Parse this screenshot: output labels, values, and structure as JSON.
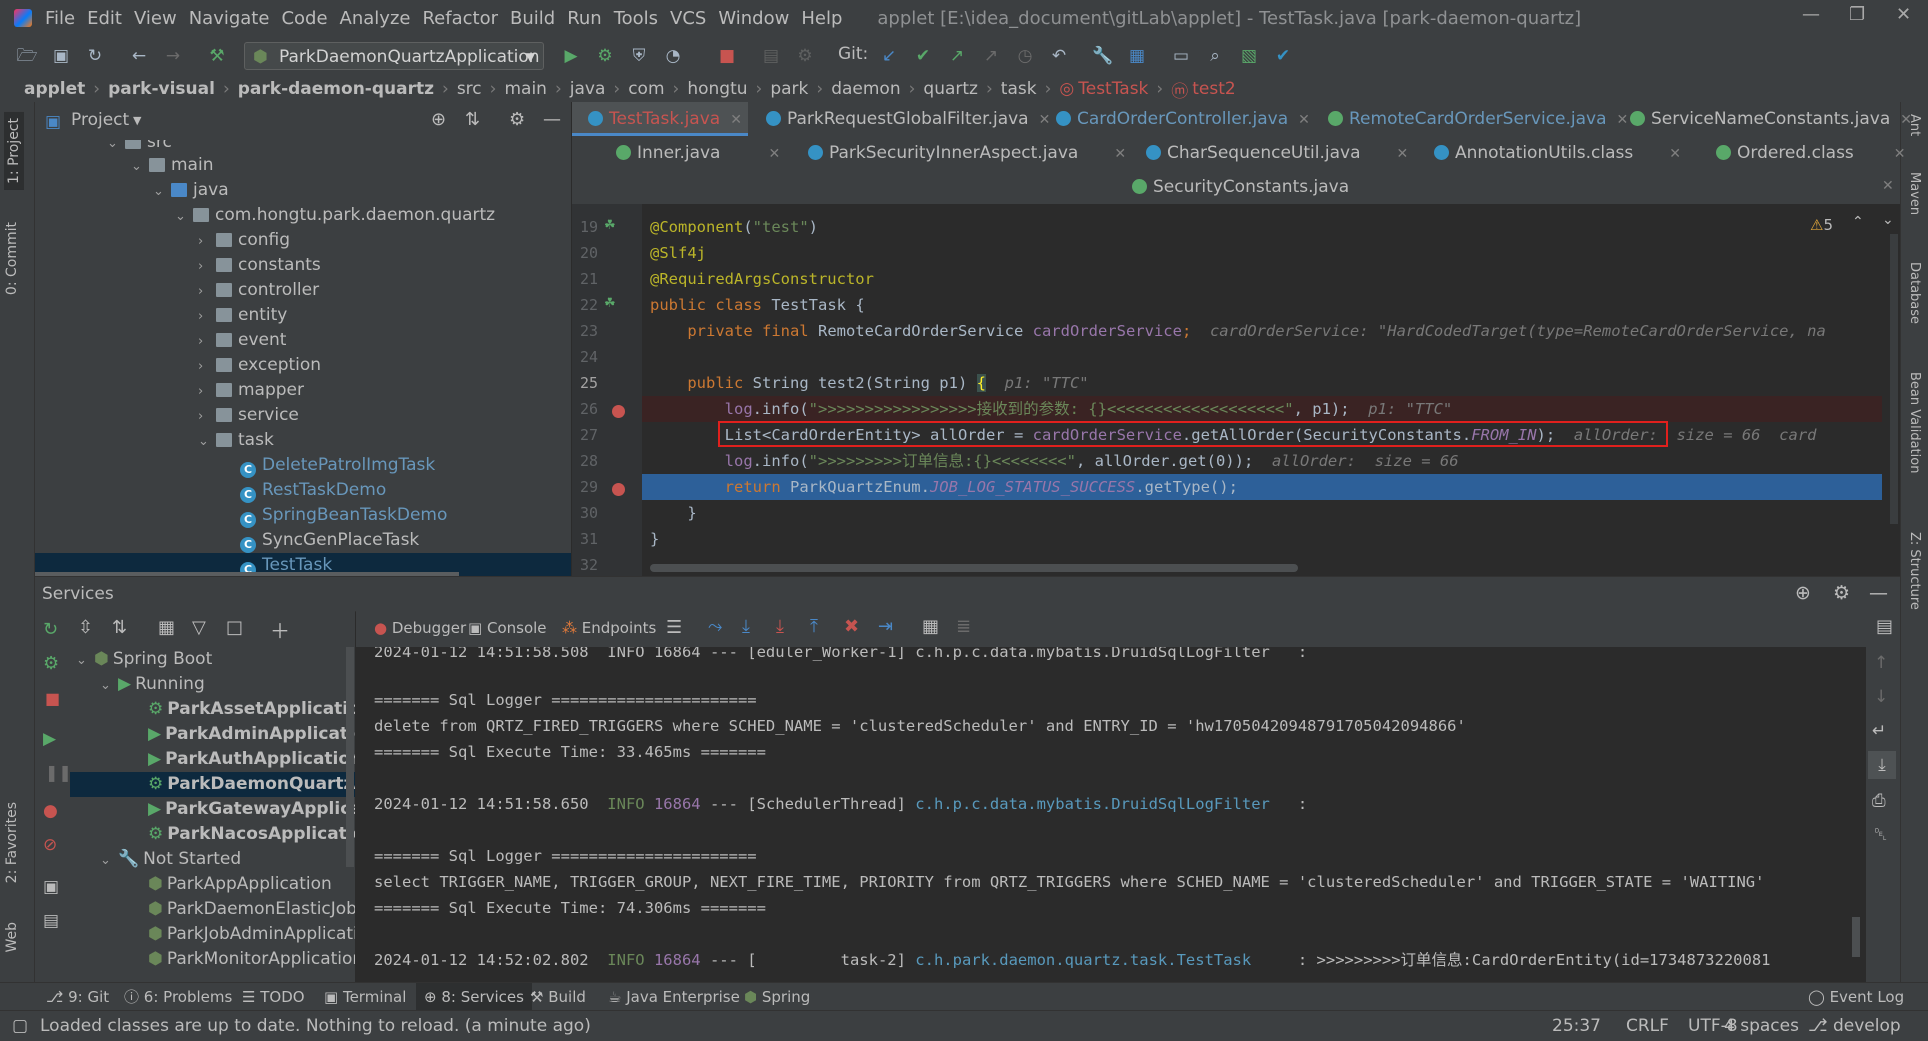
{
  "menu": {
    "items": [
      "File",
      "Edit",
      "View",
      "Navigate",
      "Code",
      "Analyze",
      "Refactor",
      "Build",
      "Run",
      "Tools",
      "VCS",
      "Window",
      "Help"
    ],
    "window_title": "applet [E:\\idea_document\\gitLab\\applet] - TestTask.java [park-daemon-quartz]"
  },
  "toolbar": {
    "run_config": "ParkDaemonQuartzApplication",
    "git_label": "Git:"
  },
  "breadcrumb": [
    "applet",
    "park-visual",
    "park-daemon-quartz",
    "src",
    "main",
    "java",
    "com",
    "hongtu",
    "park",
    "daemon",
    "quartz",
    "task",
    "TestTask",
    "test2"
  ],
  "project_panel": {
    "title": "Project",
    "tree": [
      {
        "label": "src",
        "type": "folder"
      },
      {
        "label": "main",
        "type": "folder"
      },
      {
        "label": "java",
        "type": "folder"
      },
      {
        "label": "com.hongtu.park.daemon.quartz",
        "type": "folder"
      },
      {
        "label": "config",
        "type": "folder"
      },
      {
        "label": "constants",
        "type": "folder"
      },
      {
        "label": "controller",
        "type": "folder"
      },
      {
        "label": "entity",
        "type": "folder"
      },
      {
        "label": "event",
        "type": "folder"
      },
      {
        "label": "exception",
        "type": "folder"
      },
      {
        "label": "mapper",
        "type": "folder"
      },
      {
        "label": "service",
        "type": "folder"
      },
      {
        "label": "task",
        "type": "folder"
      },
      {
        "label": "DeletePatrolImgTask",
        "type": "class"
      },
      {
        "label": "RestTaskDemo",
        "type": "class"
      },
      {
        "label": "SpringBeanTaskDemo",
        "type": "class"
      },
      {
        "label": "SyncGenPlaceTask",
        "type": "class"
      },
      {
        "label": "TestTask",
        "type": "class"
      }
    ]
  },
  "editor_tabs": {
    "row1": [
      "TestTask.java",
      "ParkRequestGlobalFilter.java",
      "CardOrderController.java",
      "RemoteCardOrderService.java",
      "ServiceNameConstants.java"
    ],
    "row2": [
      "Inner.java",
      "ParkSecurityInnerAspect.java",
      "CharSequenceUtil.java",
      "AnnotationUtils.class",
      "Ordered.class"
    ],
    "row3": [
      "SecurityConstants.java"
    ]
  },
  "editor": {
    "warnings": "5",
    "line_numbers": [
      "19",
      "20",
      "21",
      "22",
      "23",
      "24",
      "25",
      "26",
      "27",
      "28",
      "29",
      "30",
      "31",
      "32"
    ],
    "lines": {
      "l19a": "@Component",
      "l19b": "(",
      "l19c": "\"test\"",
      "l19d": ")",
      "l20": "@Slf4j",
      "l21": "@RequiredArgsConstructor",
      "l22a": "public class ",
      "l22b": "TestTask {",
      "l23a": "    private final ",
      "l23b": "RemoteCardOrderService ",
      "l23c": "cardOrderService",
      "l23d": ";",
      "l23hint": "  cardOrderService: \"HardCodedTarget(type=RemoteCardOrderService, na",
      "l25a": "    public ",
      "l25b": "String test2(String p1) ",
      "l25c": "{",
      "l25hint": "  p1: \"TTC\"",
      "l26a": "        log",
      "l26b": ".info(",
      "l26c": "\">>>>>>>>>>>>>>>>>接收到的参数: {}<<<<<<<<<<<<<<<<<<<\"",
      "l26d": ", p1);",
      "l26hint": "  p1: \"TTC\"",
      "l27a": "        List<CardOrderEntity> allOrder = ",
      "l27b": "cardOrderService",
      "l27c": ".getAllOrder(SecurityConstants.",
      "l27d": "FROM_IN",
      "l27e": ");",
      "l27hint": "  allOrder:  size = 66  card",
      "l28a": "        log",
      "l28b": ".info(",
      "l28c": "\">>>>>>>>>订单信息:{}<<<<<<<<\"",
      "l28d": ", allOrder.get(0));",
      "l28hint": "  allOrder:  size = 66",
      "l29a": "        return ",
      "l29b": "ParkQuartzEnum.",
      "l29c": "JOB_LOG_STATUS_SUCCESS",
      "l29d": ".getType();",
      "l30": "    }",
      "l31": "}"
    }
  },
  "services": {
    "title": "Services",
    "tree": [
      {
        "label": "Spring Boot",
        "level": 0
      },
      {
        "label": "Running",
        "level": 1
      },
      {
        "label": "ParkAssetApplication",
        "level": 2,
        "bold": true
      },
      {
        "label": "ParkAdminApplication",
        "level": 2,
        "bold": true
      },
      {
        "label": "ParkAuthApplication",
        "level": 2,
        "bold": true
      },
      {
        "label": "ParkDaemonQuartzApp",
        "level": 2,
        "bold": true
      },
      {
        "label": "ParkGatewayApplicatic",
        "level": 2,
        "bold": true
      },
      {
        "label": "ParkNacosApplication",
        "level": 2,
        "bold": true
      },
      {
        "label": "Not Started",
        "level": 1
      },
      {
        "label": "ParkAppApplication",
        "level": 2
      },
      {
        "label": "ParkDaemonElasticJobAp",
        "level": 2
      },
      {
        "label": "ParkJobAdminApplicatio",
        "level": 2
      },
      {
        "label": "ParkMonitorApplication",
        "level": 2
      }
    ],
    "debug_tabs": [
      "Debugger",
      "Console",
      "Endpoints"
    ]
  },
  "console": {
    "l0": "2024-01-12 14:51:58.508  INFO 16864 --- [eduler_Worker-1] c.h.p.c.data.mybatis.DruidSqlLogFilter   :",
    "l1": "======= Sql Logger ======================",
    "l2": "delete from QRTZ_FIRED_TRIGGERS where SCHED_NAME = 'clusteredScheduler' and ENTRY_ID = 'hw17050420948791705042094866'",
    "l3": "======= Sql Execute Time: 33.465ms =======",
    "l4a": "2024-01-12 14:51:58.650  ",
    "l4b": "INFO ",
    "l4c": "16864",
    "l4d": " --- [SchedulerThread] ",
    "l4e": "c.h.p.c.data.mybatis.DruidSqlLogFilter",
    "l4f": "   :",
    "l5": "======= Sql Logger ======================",
    "l6": "select TRIGGER_NAME, TRIGGER_GROUP, NEXT_FIRE_TIME, PRIORITY from QRTZ_TRIGGERS where SCHED_NAME = 'clusteredScheduler' and TRIGGER_STATE = 'WAITING'",
    "l7": "======= Sql Execute Time: 74.306ms =======",
    "l8a": "2024-01-12 14:52:02.802  ",
    "l8b": "INFO ",
    "l8c": "16864",
    "l8d": " --- [         task-2] ",
    "l8e": "c.h.park.daemon.quartz.task.TestTask",
    "l8f": "     : >>>>>>>>>订单信息:CardOrderEntity(id=1734873220081"
  },
  "bottom_tabs": [
    "9: Git",
    "6: Problems",
    "TODO",
    "Terminal",
    "8: Services",
    "Build",
    "Java Enterprise",
    "Spring",
    "Event Log"
  ],
  "left_strip": [
    "1: Project",
    "0: Commit",
    "2: Favorites",
    "Web"
  ],
  "right_strip": [
    "Ant",
    "Maven",
    "Database",
    "Bean Validation",
    "Z: Structure"
  ],
  "status": {
    "message": "Loaded classes are up to date. Nothing to reload. (a minute ago)",
    "position": "25:37",
    "line_sep": "CRLF",
    "encoding": "UTF-8",
    "indent": "4 spaces",
    "branch": "develop"
  }
}
